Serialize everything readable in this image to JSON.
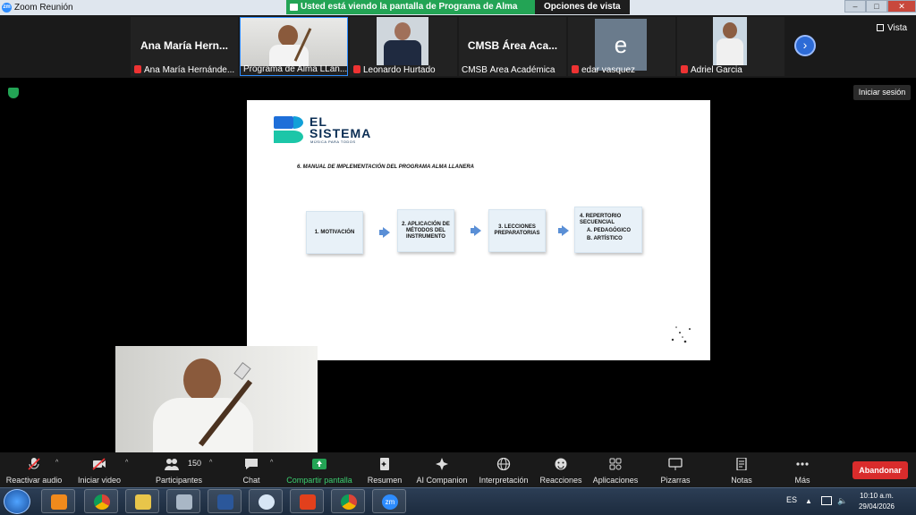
{
  "window": {
    "title": "Zoom Reunión",
    "logo_text": "zm",
    "share_banner": "Usted está viendo la pantalla de Programa de Alma LLanera",
    "view_options": "Opciones de vista",
    "controls": {
      "minimize": "–",
      "maximize": "□",
      "close": "✕"
    }
  },
  "gallery": {
    "tiles": [
      {
        "display_name": "Ana María Hern...",
        "label": "Ana María Hernánde...",
        "muted": true
      },
      {
        "display_name": "",
        "label": "Programa de Alma LLan...",
        "muted": false
      },
      {
        "display_name": "",
        "label": "Leonardo Hurtado",
        "muted": true
      },
      {
        "display_name": "CMSB Área Aca...",
        "label": "CMSB Área Académica",
        "muted": false
      },
      {
        "display_name": "e",
        "label": "edar vasquez",
        "muted": true
      },
      {
        "display_name": "",
        "label": "Adriel Garcia",
        "muted": true
      }
    ],
    "next_button": "›",
    "view_label": "Vista"
  },
  "meeting": {
    "login_button": "Iniciar sesión"
  },
  "slide": {
    "logo_line1": "EL",
    "logo_line2": "SISTEMA",
    "logo_tagline": "MÚSICA PARA TODOS",
    "heading": "6. MANUAL DE IMPLEMENTACIÓN DEL PROGRAMA ALMA LLANERA",
    "steps": [
      {
        "text": "1. MOTIVACIÓN"
      },
      {
        "text": "2. APLICACIÓN DE MÉTODOS DEL INSTRUMENTO"
      },
      {
        "text": "3. LECCIONES PREPARATORIAS"
      },
      {
        "text": "4. REPERTORIO SECUENCIAL",
        "sub": [
          "A.  PEDAGÓGICO",
          "B.  ARTÍSTICO"
        ]
      }
    ]
  },
  "toolbar": {
    "items": [
      {
        "label": "Reactivar audio"
      },
      {
        "label": "Iniciar video"
      },
      {
        "label": "Participantes",
        "count": "150"
      },
      {
        "label": "Chat"
      },
      {
        "label": "Compartir pantalla"
      },
      {
        "label": "Resumen"
      },
      {
        "label": "AI Companion"
      },
      {
        "label": "Interpretación"
      },
      {
        "label": "Reacciones"
      },
      {
        "label": "Aplicaciones"
      },
      {
        "label": "Pizarras"
      },
      {
        "label": "Notas"
      },
      {
        "label": "Más"
      }
    ],
    "leave_button": "Abandonar"
  },
  "taskbar": {
    "lang": "ES",
    "time": "10:10 a.m.",
    "date": "29/04/2026",
    "zoom_app": "zm"
  },
  "colors": {
    "zoom_blue": "#2d8cff",
    "share_green": "#23a455",
    "leave_red": "#d92c2c",
    "brand_navy": "#0b2e54"
  }
}
